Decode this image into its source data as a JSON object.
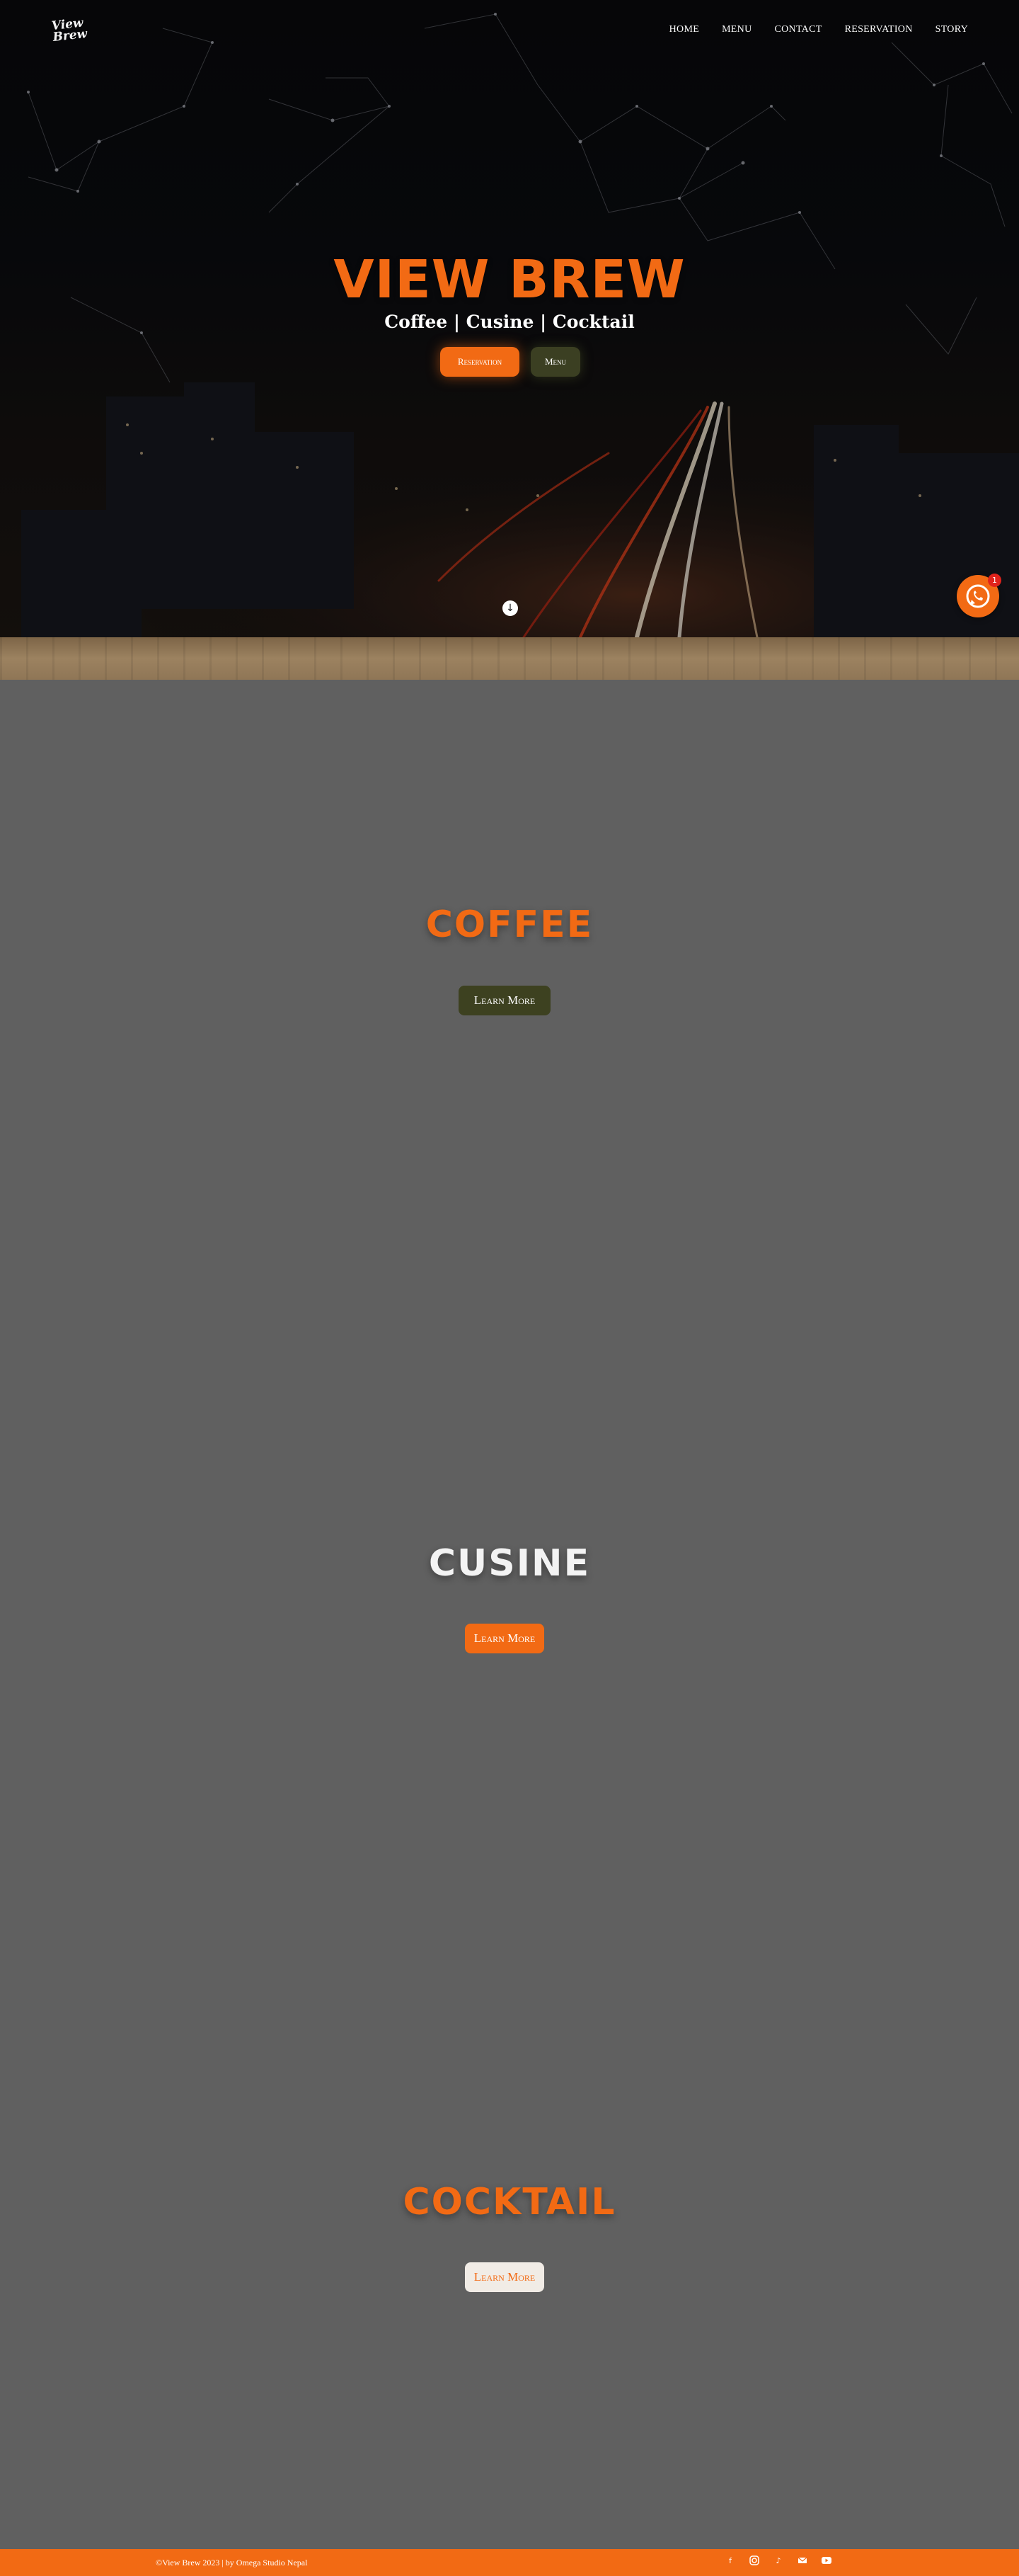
{
  "brand": {
    "logo_text_1": "View",
    "logo_text_2": "Brew"
  },
  "nav": {
    "items": [
      "HOME",
      "MENU",
      "CONTACT",
      "RESERVATION",
      "STORY"
    ]
  },
  "hero": {
    "title": "VIEW BREW",
    "subtitle": "Coffee | Cusine | Cocktail",
    "reservation_label": "Reservation",
    "menu_label": "Menu",
    "scroll_icon": "arrow-down-circle-icon"
  },
  "whatsapp": {
    "badge": "1",
    "icon": "whatsapp-icon"
  },
  "sections": [
    {
      "title": "COFFEE",
      "button_label": "Learn More",
      "title_color": "#f26a14",
      "button_color": "#3d4120"
    },
    {
      "title": "CUSINE",
      "button_label": "Learn More",
      "title_color": "#f3f3f3",
      "button_color": "#f26a14"
    },
    {
      "title": "COCKTAIL",
      "button_label": "Learn More",
      "title_color": "#f26a14",
      "button_color": "#f1ece6"
    }
  ],
  "footer": {
    "copyright": "©View Brew 2023 | by Omega Studio Nepal",
    "socials": [
      "facebook-icon",
      "instagram-icon",
      "tiktok-icon",
      "email-icon",
      "youtube-icon"
    ]
  },
  "colors": {
    "accent": "#f26a14",
    "olive": "#3d4120",
    "page_bg": "#606060",
    "hero_bg": "#0a0b0f"
  }
}
